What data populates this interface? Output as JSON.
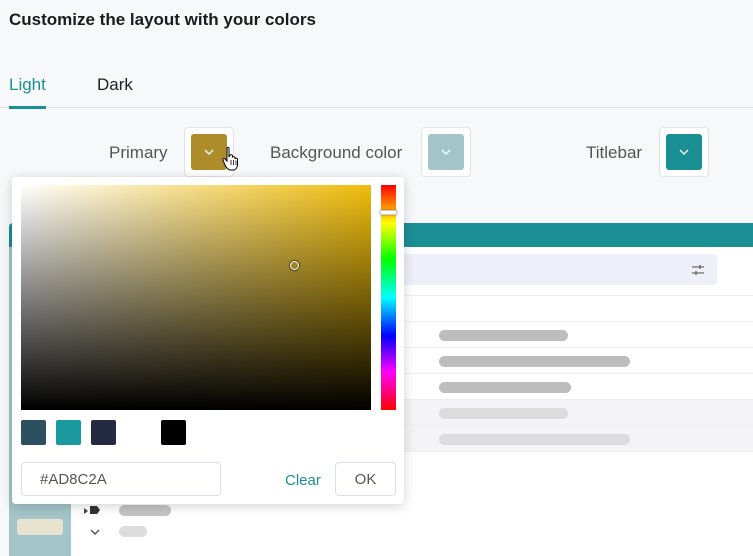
{
  "page": {
    "title": "Customize the layout with your colors"
  },
  "tabs": [
    {
      "label": "Light",
      "active": true
    },
    {
      "label": "Dark",
      "active": false
    }
  ],
  "colors": {
    "primary": {
      "label": "Primary",
      "value": "#AD8C2A"
    },
    "background": {
      "label": "Background color",
      "value": "#A3C4C8"
    },
    "titlebar": {
      "label": "Titlebar",
      "value": "#1A8F94"
    }
  },
  "picker": {
    "hex_value": "#AD8C2A",
    "clear_label": "Clear",
    "ok_label": "OK",
    "hue_color": "#F0BD0B",
    "presets": [
      "#2C5060",
      "#1A9A9E",
      "#242A42",
      "#FFFFFF",
      "#000000"
    ]
  },
  "icons": {
    "swatch_dropdown": "chevron-down-icon",
    "search_filter": "sliders-icon",
    "tree_expanded": "chevron-down-icon",
    "tree_collapsed": "caret-right-icon",
    "pointer": "hand-pointer-icon"
  }
}
